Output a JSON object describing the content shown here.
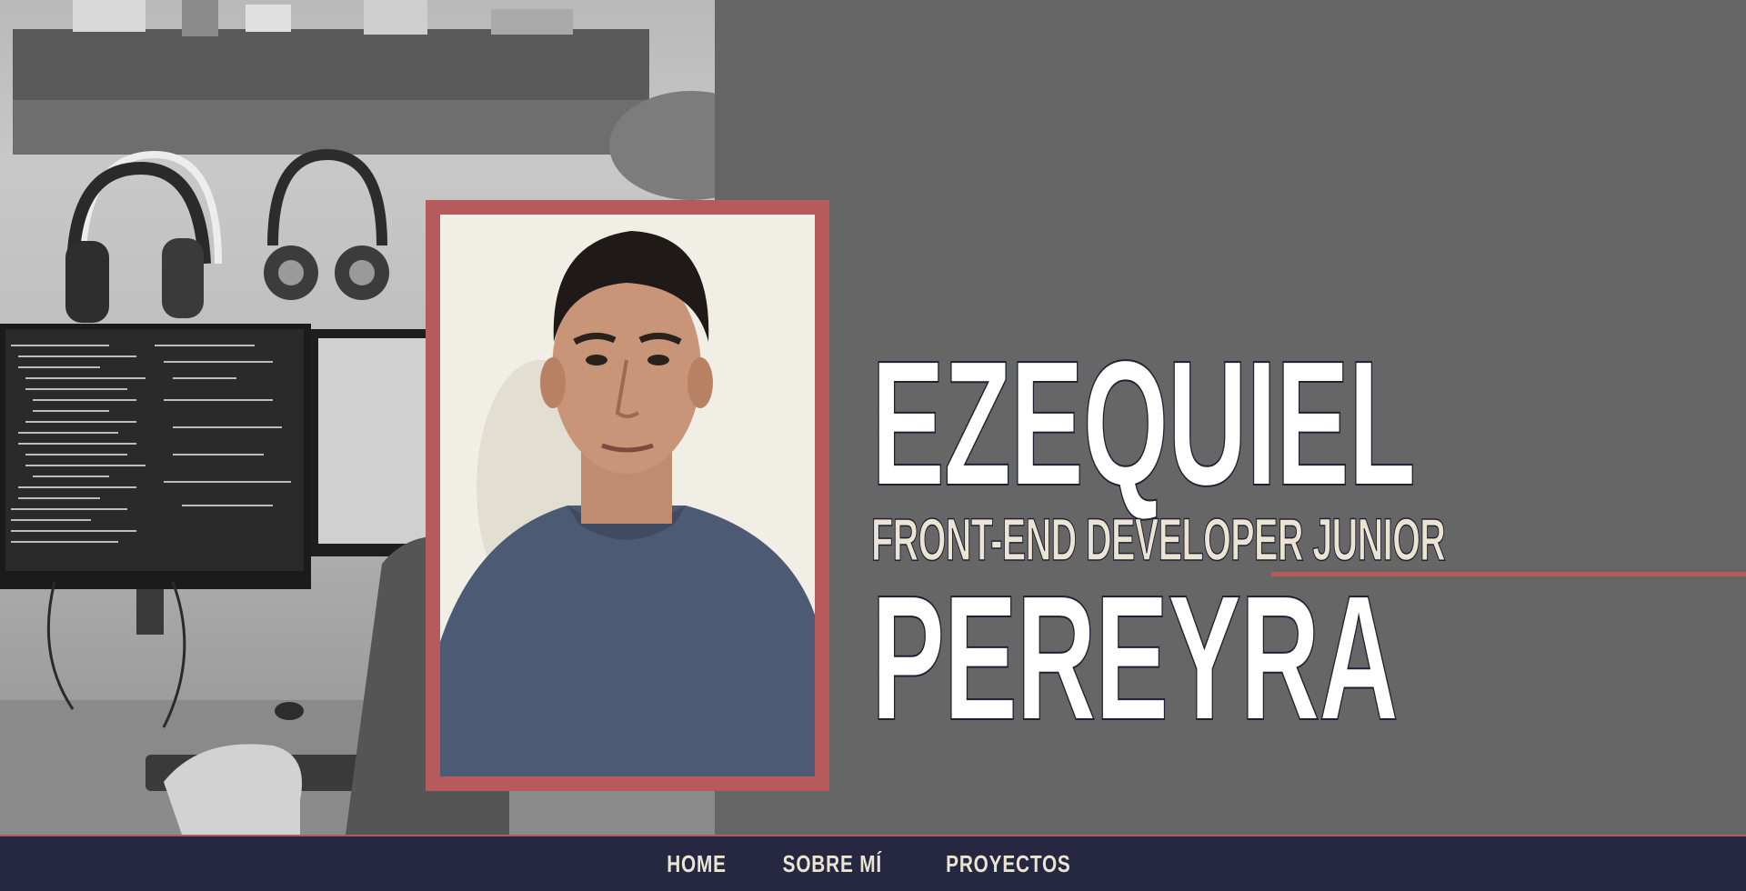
{
  "hero": {
    "first_name": "EZEQUIEL",
    "role": "FRONT-END DEVELOPER JUNIOR",
    "last_name": "PEREYRA"
  },
  "colors": {
    "background": "#666666",
    "accent": "#b65a5b",
    "nav_background": "#252840",
    "name_text": "#ffffff",
    "role_text": "#ece4d3"
  },
  "nav": {
    "items": [
      {
        "label": "HOME"
      },
      {
        "label": "SOBRE MÍ"
      },
      {
        "label": "PROYECTOS"
      }
    ]
  }
}
